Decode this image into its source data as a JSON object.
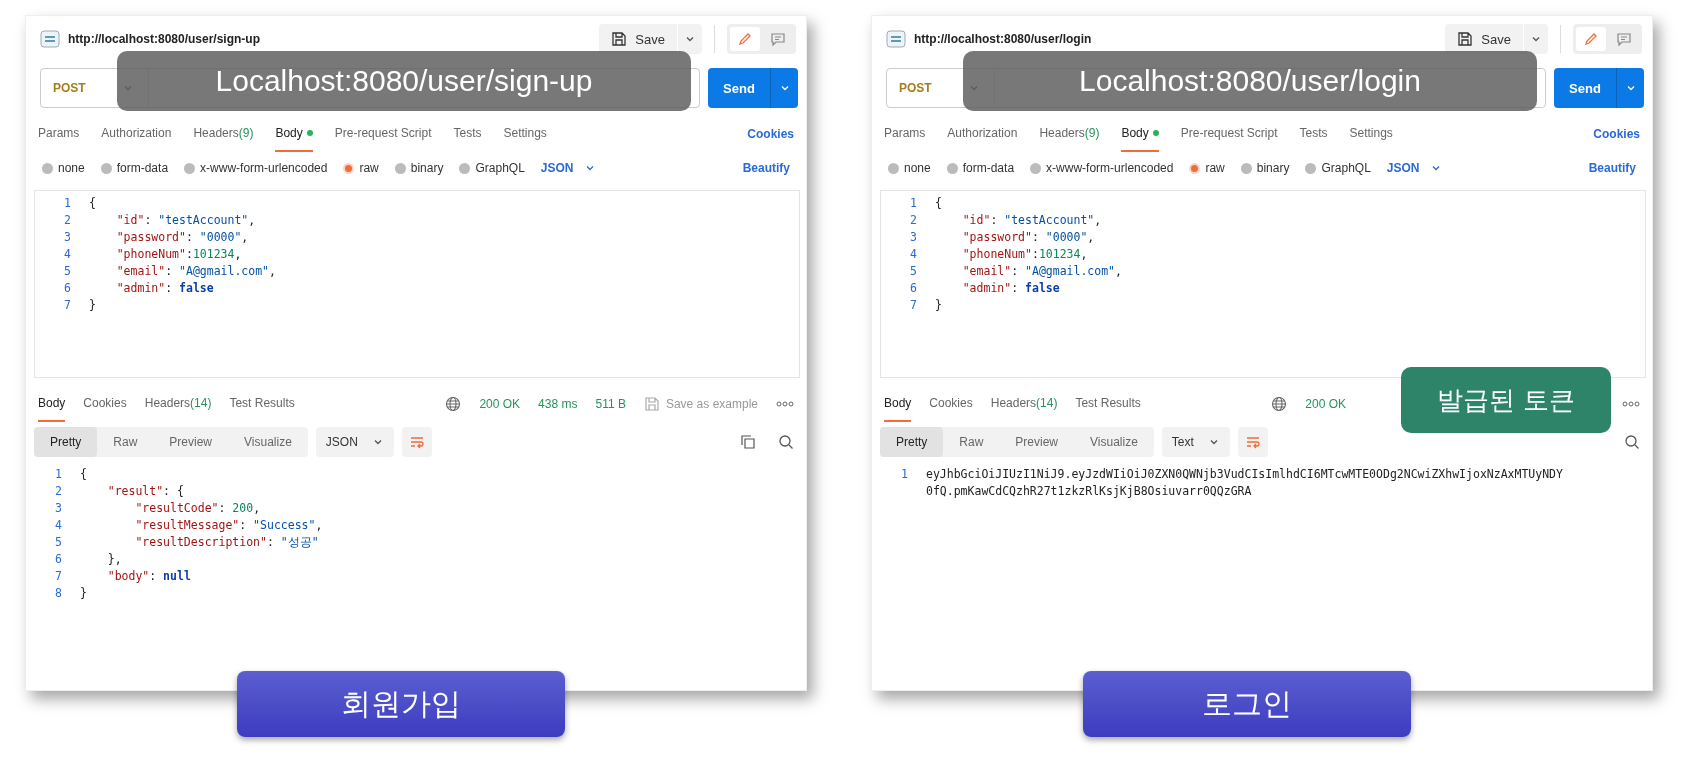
{
  "panels": [
    {
      "request_title": "http://localhost:8080/user/sign-up",
      "save": "Save",
      "method": "POST",
      "send": "Send",
      "tabs": [
        {
          "label": "Params",
          "selected": false,
          "modified": false
        },
        {
          "label": "Authorization",
          "selected": false,
          "modified": false
        },
        {
          "label": "Headers",
          "count": "(9)",
          "selected": false,
          "modified": false
        },
        {
          "label": "Body",
          "selected": true,
          "modified": true
        },
        {
          "label": "Pre-request Script",
          "selected": false,
          "modified": false
        },
        {
          "label": "Tests",
          "selected": false,
          "modified": false
        },
        {
          "label": "Settings",
          "selected": false,
          "modified": false
        }
      ],
      "cookies": "Cookies",
      "body_types": [
        {
          "label": "none",
          "selected": false
        },
        {
          "label": "form-data",
          "selected": false
        },
        {
          "label": "x-www-form-urlencoded",
          "selected": false
        },
        {
          "label": "raw",
          "selected": true
        },
        {
          "label": "binary",
          "selected": false
        },
        {
          "label": "GraphQL",
          "selected": false
        }
      ],
      "body_format": "JSON",
      "beautify": "Beautify",
      "request_lines": [
        {
          "n": "1",
          "tokens": [
            {
              "kind": "p",
              "t": "{"
            }
          ]
        },
        {
          "n": "2",
          "tokens": [
            {
              "kind": "key",
              "t": "    \"id\""
            },
            {
              "kind": "p",
              "t": ": "
            },
            {
              "kind": "str",
              "t": "\"testAccount\""
            },
            {
              "kind": "p",
              "t": ","
            }
          ]
        },
        {
          "n": "3",
          "tokens": [
            {
              "kind": "key",
              "t": "    \"password\""
            },
            {
              "kind": "p",
              "t": ": "
            },
            {
              "kind": "str",
              "t": "\"0000\""
            },
            {
              "kind": "p",
              "t": ","
            }
          ]
        },
        {
          "n": "4",
          "tokens": [
            {
              "kind": "key",
              "t": "    \"phoneNum\""
            },
            {
              "kind": "p",
              "t": ":"
            },
            {
              "kind": "num",
              "t": "101234"
            },
            {
              "kind": "p",
              "t": ","
            }
          ]
        },
        {
          "n": "5",
          "tokens": [
            {
              "kind": "key",
              "t": "    \"email\""
            },
            {
              "kind": "p",
              "t": ": "
            },
            {
              "kind": "str",
              "t": "\"A@gmail.com\""
            },
            {
              "kind": "p",
              "t": ","
            }
          ]
        },
        {
          "n": "6",
          "tokens": [
            {
              "kind": "key",
              "t": "    \"admin\""
            },
            {
              "kind": "p",
              "t": ": "
            },
            {
              "kind": "kw",
              "t": "false"
            }
          ]
        },
        {
          "n": "7",
          "tokens": [
            {
              "kind": "p",
              "t": "}"
            }
          ]
        }
      ],
      "response_tabs": [
        {
          "label": "Body",
          "selected": true
        },
        {
          "label": "Cookies",
          "selected": false
        },
        {
          "label": "Headers",
          "count": "(14)",
          "selected": false
        },
        {
          "label": "Test Results",
          "selected": false
        }
      ],
      "status": {
        "code": "200 OK",
        "time": "438 ms",
        "size": "511 B",
        "save_example": "Save as example"
      },
      "view_tabs": [
        {
          "label": "Pretty",
          "selected": true
        },
        {
          "label": "Raw",
          "selected": false
        },
        {
          "label": "Preview",
          "selected": false
        },
        {
          "label": "Visualize",
          "selected": false
        }
      ],
      "response_format": "JSON",
      "tool_icons": [
        {
          "kind": "copy"
        },
        {
          "kind": "search"
        }
      ],
      "response_lines": [
        {
          "n": "1",
          "tokens": [
            {
              "kind": "p",
              "t": "{"
            }
          ]
        },
        {
          "n": "2",
          "tokens": [
            {
              "kind": "key",
              "t": "    \"result\""
            },
            {
              "kind": "p",
              "t": ": {"
            }
          ]
        },
        {
          "n": "3",
          "tokens": [
            {
              "kind": "key",
              "t": "        \"resultCode\""
            },
            {
              "kind": "p",
              "t": ": "
            },
            {
              "kind": "num",
              "t": "200"
            },
            {
              "kind": "p",
              "t": ","
            }
          ]
        },
        {
          "n": "4",
          "tokens": [
            {
              "kind": "key",
              "t": "        \"resultMessage\""
            },
            {
              "kind": "p",
              "t": ": "
            },
            {
              "kind": "str",
              "t": "\"Success\""
            },
            {
              "kind": "p",
              "t": ","
            }
          ]
        },
        {
          "n": "5",
          "tokens": [
            {
              "kind": "key",
              "t": "        \"resultDescription\""
            },
            {
              "kind": "p",
              "t": ": "
            },
            {
              "kind": "str",
              "t": "\"성공\""
            }
          ]
        },
        {
          "n": "6",
          "tokens": [
            {
              "kind": "p",
              "t": "    },"
            }
          ]
        },
        {
          "n": "7",
          "tokens": [
            {
              "kind": "key",
              "t": "    \"body\""
            },
            {
              "kind": "p",
              "t": ": "
            },
            {
              "kind": "kw",
              "t": "null"
            }
          ]
        },
        {
          "n": "8",
          "tokens": [
            {
              "kind": "p",
              "t": "}"
            }
          ]
        }
      ],
      "url_banner": "Localhost:8080/user/sign-up",
      "caption": "회원가입"
    },
    {
      "request_title": "http://localhost:8080/user/login",
      "save": "Save",
      "method": "POST",
      "send": "Send",
      "tabs": [
        {
          "label": "Params",
          "selected": false,
          "modified": false
        },
        {
          "label": "Authorization",
          "selected": false,
          "modified": false
        },
        {
          "label": "Headers",
          "count": "(9)",
          "selected": false,
          "modified": false
        },
        {
          "label": "Body",
          "selected": true,
          "modified": true
        },
        {
          "label": "Pre-request Script",
          "selected": false,
          "modified": false
        },
        {
          "label": "Tests",
          "selected": false,
          "modified": false
        },
        {
          "label": "Settings",
          "selected": false,
          "modified": false
        }
      ],
      "cookies": "Cookies",
      "body_types": [
        {
          "label": "none",
          "selected": false
        },
        {
          "label": "form-data",
          "selected": false
        },
        {
          "label": "x-www-form-urlencoded",
          "selected": false
        },
        {
          "label": "raw",
          "selected": true
        },
        {
          "label": "binary",
          "selected": false
        },
        {
          "label": "GraphQL",
          "selected": false
        }
      ],
      "body_format": "JSON",
      "beautify": "Beautify",
      "request_lines": [
        {
          "n": "1",
          "tokens": [
            {
              "kind": "p",
              "t": "{"
            }
          ]
        },
        {
          "n": "2",
          "tokens": [
            {
              "kind": "key",
              "t": "    \"id\""
            },
            {
              "kind": "p",
              "t": ": "
            },
            {
              "kind": "str",
              "t": "\"testAccount\""
            },
            {
              "kind": "p",
              "t": ","
            }
          ]
        },
        {
          "n": "3",
          "tokens": [
            {
              "kind": "key",
              "t": "    \"password\""
            },
            {
              "kind": "p",
              "t": ": "
            },
            {
              "kind": "str",
              "t": "\"0000\""
            },
            {
              "kind": "p",
              "t": ","
            }
          ]
        },
        {
          "n": "4",
          "tokens": [
            {
              "kind": "key",
              "t": "    \"phoneNum\""
            },
            {
              "kind": "p",
              "t": ":"
            },
            {
              "kind": "num",
              "t": "101234"
            },
            {
              "kind": "p",
              "t": ","
            }
          ]
        },
        {
          "n": "5",
          "tokens": [
            {
              "kind": "key",
              "t": "    \"email\""
            },
            {
              "kind": "p",
              "t": ": "
            },
            {
              "kind": "str",
              "t": "\"A@gmail.com\""
            },
            {
              "kind": "p",
              "t": ","
            }
          ]
        },
        {
          "n": "6",
          "tokens": [
            {
              "kind": "key",
              "t": "    \"admin\""
            },
            {
              "kind": "p",
              "t": ": "
            },
            {
              "kind": "kw",
              "t": "false"
            }
          ]
        },
        {
          "n": "7",
          "tokens": [
            {
              "kind": "p",
              "t": "}"
            }
          ]
        }
      ],
      "response_tabs": [
        {
          "label": "Body",
          "selected": true
        },
        {
          "label": "Cookies",
          "selected": false
        },
        {
          "label": "Headers",
          "count": "(14)",
          "selected": false
        },
        {
          "label": "Test Results",
          "selected": false
        }
      ],
      "status": {
        "code": "200 OK"
      },
      "view_tabs": [
        {
          "label": "Pretty",
          "selected": true
        },
        {
          "label": "Raw",
          "selected": false
        },
        {
          "label": "Preview",
          "selected": false
        },
        {
          "label": "Visualize",
          "selected": false
        }
      ],
      "response_format": "Text",
      "tool_icons": [
        {
          "kind": "search"
        }
      ],
      "response_lines": [
        {
          "n": "1",
          "tokens": [
            {
              "kind": "p",
              "t": "eyJhbGciOiJIUzI1NiJ9.eyJzdWIiOiJ0ZXN0QWNjb3VudCIsImlhdCI6MTcwMTE0ODg2NCwiZXhwIjoxNzAxMTUyNDY0fQ.pmKawCdCQzhR27t1zkzRlKsjKjB8Osiuvarr0QQzGRA"
            }
          ]
        }
      ],
      "url_banner": "Localhost:8080/user/login",
      "caption": "로그인",
      "callout": "발급된 토큰"
    }
  ]
}
